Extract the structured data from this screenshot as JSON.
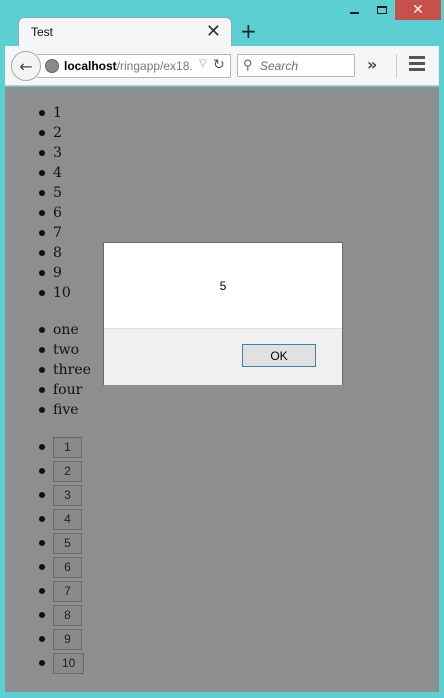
{
  "window": {
    "minimize_glyph": "",
    "close_glyph": "✕"
  },
  "tab": {
    "title": "Test",
    "close_glyph": "✕"
  },
  "new_tab_glyph": "+",
  "navbar": {
    "back_glyph": "←",
    "url_host": "localhost",
    "url_path": "/ringapp/ex18.",
    "url_drop_glyph": "▽",
    "reload_glyph": "↻",
    "search_placeholder": "Search",
    "search_glyph": "⚲",
    "overflow_glyph": "»"
  },
  "content": {
    "numbers": [
      "1",
      "2",
      "3",
      "4",
      "5",
      "6",
      "7",
      "8",
      "9",
      "10"
    ],
    "words": [
      "one",
      "two",
      "three",
      "four",
      "five"
    ],
    "buttons": [
      "1",
      "2",
      "3",
      "4",
      "5",
      "6",
      "7",
      "8",
      "9",
      "10"
    ]
  },
  "dialog": {
    "message": "5",
    "ok_label": "OK"
  },
  "colors": {
    "titlebar": "#5ccfd2",
    "close_button": "#c7504b",
    "page_overlay": "#8d8e90"
  }
}
